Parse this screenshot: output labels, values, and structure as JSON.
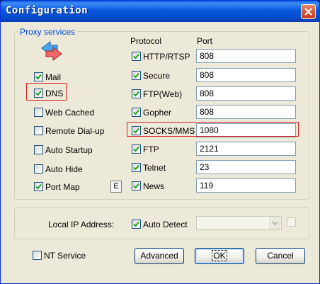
{
  "window": {
    "title": "Configuration"
  },
  "proxy_services": {
    "legend": "Proxy services",
    "services": [
      {
        "label": "Mail",
        "checked": true
      },
      {
        "label": "DNS",
        "checked": true
      },
      {
        "label": "Web Cached",
        "checked": false
      },
      {
        "label": "Remote Dial-up",
        "checked": false
      },
      {
        "label": "Auto Startup",
        "checked": false
      },
      {
        "label": "Auto Hide",
        "checked": false
      },
      {
        "label": "Port Map",
        "checked": true
      }
    ],
    "edit_button_label": "E",
    "protocol_header": "Protocol",
    "port_header": "Port",
    "protocols": [
      {
        "label": "HTTP/RTSP",
        "checked": true,
        "port": "808"
      },
      {
        "label": "Secure",
        "checked": true,
        "port": "808"
      },
      {
        "label": "FTP(Web)",
        "checked": true,
        "port": "808"
      },
      {
        "label": "Gopher",
        "checked": true,
        "port": "808"
      },
      {
        "label": "SOCKS/MMS",
        "checked": true,
        "port": "1080"
      },
      {
        "label": "FTP",
        "checked": true,
        "port": "2121"
      },
      {
        "label": "Telnet",
        "checked": true,
        "port": "23"
      },
      {
        "label": "News",
        "checked": true,
        "port": "119"
      }
    ]
  },
  "local_ip": {
    "label": "Local IP Address:",
    "auto_detect_label": "Auto Detect",
    "auto_detect_checked": true,
    "value": ""
  },
  "footer": {
    "nt_service_label": "NT Service",
    "nt_service_checked": false,
    "advanced_label": "Advanced",
    "ok_label": "OK",
    "cancel_label": "Cancel"
  },
  "colors": {
    "title_bar": "#0858e0",
    "legend": "#0046d5",
    "highlight_box": "#d81e1e",
    "close_button": "#d4543a"
  },
  "icons": [
    "close-icon",
    "arrows-icon",
    "check-icon",
    "chevron-down-icon"
  ]
}
